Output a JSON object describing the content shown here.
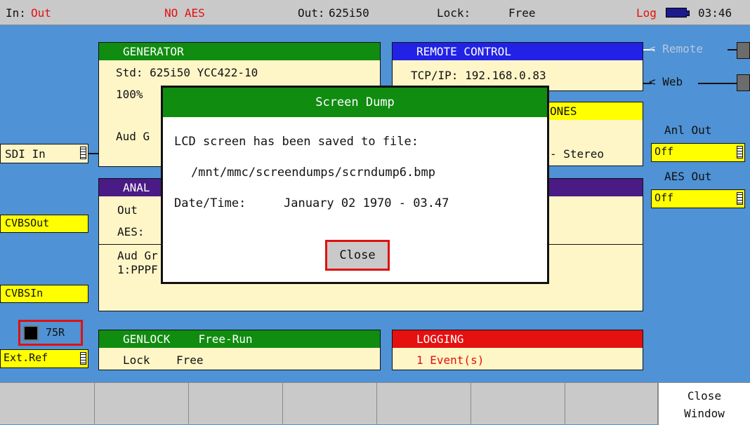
{
  "status_bar": {
    "in_label": "In:",
    "in_value": "Out",
    "aes_status": "NO AES",
    "out_label": "Out:",
    "out_value": "625i50",
    "lock_label": "Lock:",
    "lock_value": "Free",
    "log_label": "Log",
    "battery_icon": "battery-icon",
    "time": "03:46"
  },
  "generator": {
    "title": "GENERATOR",
    "std": "Std: 625i50 YCC422-10",
    "line2": "100%",
    "line3": "Aud G"
  },
  "remote_control": {
    "title": "REMOTE CONTROL",
    "tcpip": "TCP/IP: 192.168.0.83",
    "remote_label": "< Remote",
    "web_label": "< Web"
  },
  "tones": {
    "title": "ONES",
    "value": "- Stereo"
  },
  "analog": {
    "title": "ANAL",
    "out_label": "Out",
    "aes_label": "AES:",
    "aud_label": "Aud Gr",
    "aud_value": "1:PPPF"
  },
  "genlock": {
    "title": "GENLOCK",
    "mode": "Free-Run",
    "lock_label": "Lock",
    "lock_value": "Free"
  },
  "logging": {
    "title": "LOGGING",
    "events": "1 Event(s)"
  },
  "side_left": {
    "sdi_in": "SDI In",
    "cvbs_out": "CVBSOut",
    "cvbs_in": "CVBSIn",
    "termination": "75R",
    "ext_ref": "Ext.Ref"
  },
  "side_right": {
    "anl_out_label": "Anl Out",
    "anl_out_value": "Off",
    "aes_out_label": "AES Out",
    "aes_out_value": "Off"
  },
  "dialog": {
    "title": "Screen Dump",
    "message": "LCD screen has been saved to file:",
    "path": "/mnt/mmc/screendumps/scrndump6.bmp",
    "datetime_label": "Date/Time:",
    "datetime_value": "January 02 1970 - 03.47",
    "close_label": "Close"
  },
  "softkeys": {
    "close_window_line1": "Close",
    "close_window_line2": "Window"
  },
  "colors": {
    "background": "#4f92d5",
    "panel_fill": "#fff6c8",
    "header_green": "#108c10",
    "header_blue": "#2222e6",
    "header_purple": "#4a1a85",
    "header_red": "#e51010",
    "label_yellow": "#ffff00",
    "alert_red": "#e41010"
  }
}
